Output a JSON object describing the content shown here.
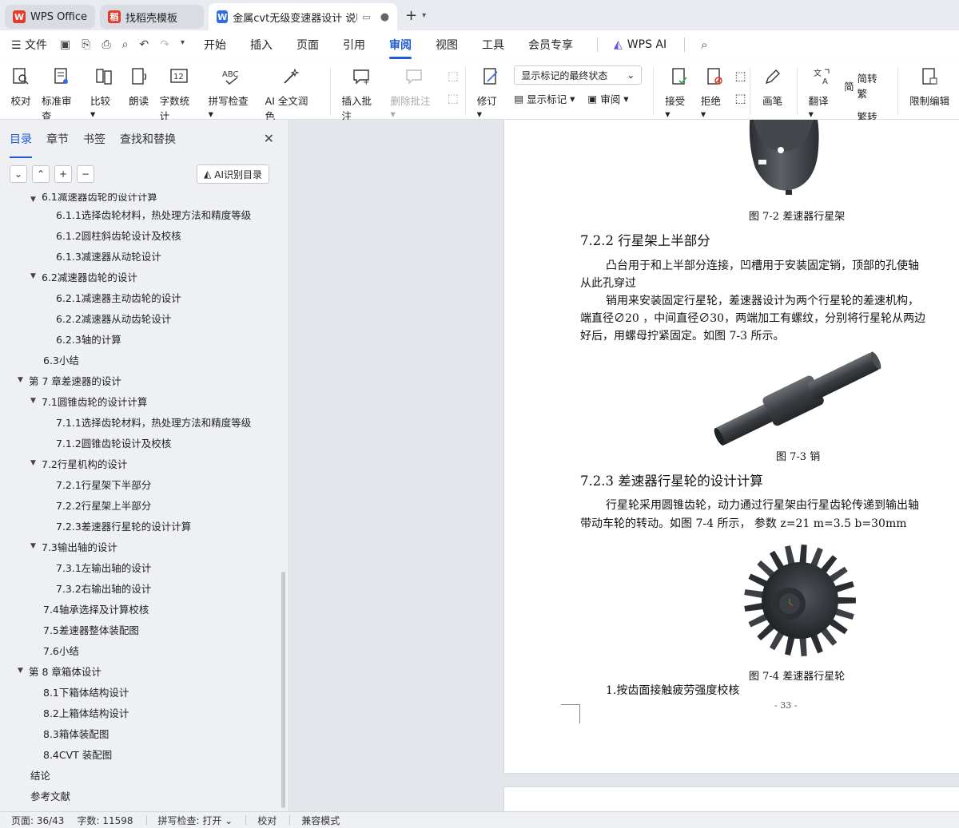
{
  "titlebar": {
    "tabs": [
      {
        "label": "WPS Office",
        "logo_color": "#e23b2e"
      },
      {
        "label": "找稻壳模板",
        "logo_color": "#e23b2e"
      },
      {
        "label": "金属cvt无级变速器设计 说明书",
        "logo_color": "#2f6ce5"
      }
    ]
  },
  "menubar": {
    "file": "文件",
    "items": [
      "开始",
      "插入",
      "页面",
      "引用",
      "审阅",
      "视图",
      "工具",
      "会员专享"
    ],
    "active": "审阅",
    "wps_ai": "WPS AI"
  },
  "ribbon": {
    "proofread": "校对",
    "standard_review": "标准审查",
    "compare": "比较",
    "read_aloud": "朗读",
    "word_count": "字数统计",
    "spell_check": "拼写检查",
    "ai_polish": "AI 全文润色",
    "insert_comment": "插入批注",
    "delete_comment": "删除批注",
    "revise": "修订",
    "markup_select": "显示标记的最终状态",
    "show_markup": "显示标记",
    "review": "审阅",
    "accept": "接受",
    "reject": "拒绝",
    "pen": "画笔",
    "translate": "翻译",
    "to_traditional": "简转繁",
    "to_simplified": "繁转简",
    "restrict_edit": "限制编辑"
  },
  "leftpanel": {
    "tabs": [
      "目录",
      "章节",
      "书签",
      "查找和替换"
    ],
    "ai_toc": "AI识别目录",
    "toc": [
      {
        "level": 1,
        "label": "6.1减速器齿轮的设计计算",
        "arrow": "down",
        "partial": true
      },
      {
        "level": 2,
        "label": "6.1.1选择齿轮材料，热处理方法和精度等级"
      },
      {
        "level": 2,
        "label": "6.1.2圆柱斜齿轮设计及校核"
      },
      {
        "level": 2,
        "label": "6.1.3减速器从动轮设计"
      },
      {
        "level": 1,
        "label": "6.2减速器齿轮的设计",
        "arrow": "down"
      },
      {
        "level": 2,
        "label": "6.2.1减速器主动齿轮的设计"
      },
      {
        "level": 2,
        "label": "6.2.2减速器从动齿轮设计"
      },
      {
        "level": 2,
        "label": "6.2.3轴的计算"
      },
      {
        "level": 1,
        "label": "6.3小结"
      },
      {
        "level": 0,
        "label": "第 7 章差速器的设计",
        "arrow": "down"
      },
      {
        "level": 1,
        "label": "7.1圆锥齿轮的设计计算",
        "arrow": "down"
      },
      {
        "level": 2,
        "label": "7.1.1选择齿轮材料，热处理方法和精度等级"
      },
      {
        "level": 2,
        "label": "7.1.2圆锥齿轮设计及校核"
      },
      {
        "level": 1,
        "label": "7.2行星机构的设计",
        "arrow": "down"
      },
      {
        "level": 2,
        "label": "7.2.1行星架下半部分"
      },
      {
        "level": 2,
        "label": "7.2.2行星架上半部分"
      },
      {
        "level": 2,
        "label": "7.2.3差速器行星轮的设计计算"
      },
      {
        "level": 1,
        "label": "7.3输出轴的设计",
        "arrow": "down"
      },
      {
        "level": 2,
        "label": "7.3.1左输出轴的设计"
      },
      {
        "level": 2,
        "label": "7.3.2右输出轴的设计"
      },
      {
        "level": 1,
        "label": "7.4轴承选择及计算校核"
      },
      {
        "level": 1,
        "label": "7.5差速器整体装配图"
      },
      {
        "level": 1,
        "label": "7.6小结"
      },
      {
        "level": 0,
        "label": "第 8 章箱体设计",
        "arrow": "down"
      },
      {
        "level": 1,
        "label": "8.1下箱体结构设计"
      },
      {
        "level": 1,
        "label": "8.2上箱体结构设计"
      },
      {
        "level": 1,
        "label": "8.3箱体装配图"
      },
      {
        "level": 1,
        "label": "8.4CVT 装配图"
      },
      {
        "level": 0,
        "label": "结论"
      },
      {
        "level": 0,
        "label": "参考文献"
      }
    ]
  },
  "document": {
    "fig72_caption": "图 7-2  差速器行星架",
    "h722": "7.2.2  行星架上半部分",
    "p1_line1": "凸台用于和上半部分连接，凹槽用于安装固定销，顶部的孔使轴",
    "p1_line2": "从此孔穿过",
    "p2_line1": "销用来安装固定行星轮，差速器设计为两个行星轮的差速机构，",
    "p2_line2": "端直径∅20 ，中间直径∅30，两端加工有螺纹，分别将行星轮从两边",
    "p2_line3": "好后，用螺母拧紧固定。如图 7-3 所示。",
    "fig73_caption": "图 7-3  销",
    "h723": "7.2.3  差速器行星轮的设计计算",
    "p3_line1": "行星轮采用圆锥齿轮，动力通过行星架由行星齿轮传递到输出轴",
    "p3_line2": "带动车轮的转动。如图 7-4 所示，   参数  z=21 m=3.5    b=30mm",
    "fig74_caption": "图 7-4  差速器行星轮",
    "item1": "1.按齿面接触疲劳强度校核",
    "page_number": "- 33 -"
  },
  "statusbar": {
    "page": "页面: 36/43",
    "words": "字数: 11598",
    "spell": "拼写检查: 打开",
    "proof": "校对",
    "compat": "兼容模式"
  },
  "colors": {
    "accent": "#1c5bd8",
    "wps_red": "#e23b2e",
    "doc_blue": "#2f6ce5"
  }
}
